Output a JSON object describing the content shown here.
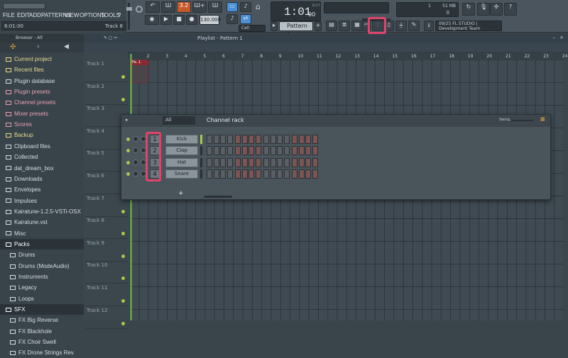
{
  "menu": {
    "items": [
      "FILE",
      "EDIT",
      "ADD",
      "PATTERNS",
      "VIEW",
      "OPTIONS",
      "TOOLS",
      "?"
    ],
    "hint_left": "6:01:00",
    "hint_right": "Track 8"
  },
  "transport": {
    "tempo": "130.000",
    "time": "1:01",
    "time_sub": "00",
    "time_label": "B:S:T",
    "pattern": "Pattern 1",
    "snap": "Cell",
    "cpu_mem": "51 MB",
    "cpu_val": "1",
    "cpu_zero": "0"
  },
  "news": {
    "line1": "09/25  FL STUDIO |",
    "line2": "Development Team"
  },
  "browser": {
    "title": "Browser - All",
    "items": [
      {
        "label": "Current project",
        "color": "#e8dc8c"
      },
      {
        "label": "Recent files",
        "color": "#e8dc8c"
      },
      {
        "label": "Plugin database",
        "color": "#d7dde1"
      },
      {
        "label": "Plugin presets",
        "color": "#e8a0b0"
      },
      {
        "label": "Channel presets",
        "color": "#e8a0b0"
      },
      {
        "label": "Mixer presets",
        "color": "#e8a0b0"
      },
      {
        "label": "Scores",
        "color": "#e8a0b0"
      },
      {
        "label": "Backup",
        "color": "#e8dc8c"
      },
      {
        "label": "Clipboard files",
        "color": "#d7dde1"
      },
      {
        "label": "Collected",
        "color": "#d7dde1"
      },
      {
        "label": "dat_dream_box",
        "color": "#d7dde1"
      },
      {
        "label": "Downloads",
        "color": "#d7dde1"
      },
      {
        "label": "Envelopes",
        "color": "#d7dde1"
      },
      {
        "label": "Impulses",
        "color": "#d7dde1"
      },
      {
        "label": "Kairatune-1.2.5-VSTi-OSX",
        "color": "#d7dde1"
      },
      {
        "label": "Kairatune.vst",
        "color": "#d7dde1"
      },
      {
        "label": "Misc",
        "color": "#d7dde1"
      },
      {
        "label": "Packs",
        "color": "#ffffff"
      },
      {
        "label": "Drums",
        "color": "#d7dde1"
      },
      {
        "label": "Drums (ModeAudio)",
        "color": "#d7dde1"
      },
      {
        "label": "Instruments",
        "color": "#d7dde1"
      },
      {
        "label": "Legacy",
        "color": "#d7dde1"
      },
      {
        "label": "Loops",
        "color": "#d7dde1"
      },
      {
        "label": "SFX",
        "color": "#ffffff"
      },
      {
        "label": "FX Big Reverse",
        "color": "#d7dde1"
      },
      {
        "label": "FX Blackhole",
        "color": "#d7dde1"
      },
      {
        "label": "FX Choir Swell",
        "color": "#d7dde1"
      },
      {
        "label": "FX Drone Strings Rev",
        "color": "#d7dde1"
      }
    ]
  },
  "playlist": {
    "title": "Playlist - Pattern 1",
    "bars": [
      "2",
      "3",
      "4",
      "5",
      "6",
      "7",
      "8",
      "9",
      "10",
      "11",
      "12",
      "13",
      "14",
      "15",
      "16",
      "17",
      "18",
      "19",
      "20",
      "21",
      "22",
      "23",
      "24"
    ],
    "tracks": [
      "Track 1",
      "Track 2",
      "Track 3",
      "Track 4",
      "Track 5",
      "Track 6",
      "Track 7",
      "Track 8",
      "Track 9",
      "Track 10",
      "Track 11",
      "Track 12"
    ],
    "clip": "Pa..1"
  },
  "rack": {
    "title": "Channel rack",
    "filter": "All",
    "swing": "Swing",
    "channels": [
      {
        "num": "1",
        "name": "Kick"
      },
      {
        "num": "2",
        "name": "Clap"
      },
      {
        "num": "3",
        "name": "Hat"
      },
      {
        "num": "4",
        "name": "Snare"
      }
    ],
    "add": "+"
  },
  "colors": {
    "highlight": "#e0436b",
    "step_dark": "#5a5f63",
    "step_red": "#7a5553"
  }
}
